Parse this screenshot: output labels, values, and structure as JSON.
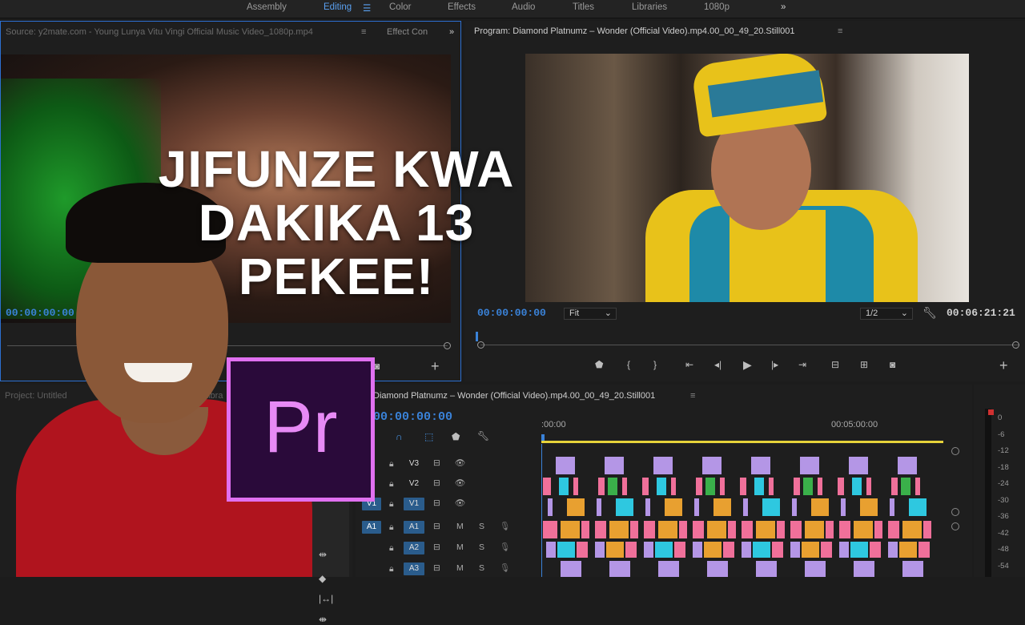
{
  "workspaces": [
    "Assembly",
    "Editing",
    "Color",
    "Effects",
    "Audio",
    "Titles",
    "Libraries",
    "1080p"
  ],
  "workspace_active": "Editing",
  "source": {
    "tab_title": "Source: y2mate.com - Young Lunya  Vitu Vingi Official Music Video_1080p.mp4",
    "tab_effect": "Effect Con",
    "timecode": "00:00:00:00"
  },
  "program": {
    "title": "Program: Diamond Platnumz – Wonder (Official Video).mp4.00_00_49_20.Still001",
    "timecode": "00:00:00:00",
    "fit": "Fit",
    "resolution": "1/2",
    "duration": "00:06:21:21"
  },
  "project": {
    "tab": "Project: Untitled",
    "tab2": "Libra"
  },
  "timeline": {
    "title": "Diamond Platnumz – Wonder (Official Video).mp4.00_00_49_20.Still001",
    "timecode": "00:00:00:00",
    "ruler": [
      ":00:00",
      "00:05:00:00"
    ],
    "tracks": [
      {
        "src": "",
        "name": "V3",
        "m": "",
        "s": ""
      },
      {
        "src": "",
        "name": "V2",
        "m": "",
        "s": ""
      },
      {
        "src": "V1",
        "name": "V1",
        "m": "",
        "s": ""
      },
      {
        "src": "A1",
        "name": "A1",
        "m": "M",
        "s": "S"
      },
      {
        "src": "",
        "name": "A2",
        "m": "M",
        "s": "S"
      },
      {
        "src": "",
        "name": "A3",
        "m": "M",
        "s": "S"
      }
    ]
  },
  "meter": {
    "scale": [
      "0",
      "-6",
      "-12",
      "-18",
      "-24",
      "-30",
      "-36",
      "-42",
      "-48",
      "-54"
    ]
  },
  "overlay": {
    "headline_lines": [
      "JIFUNZE KWA",
      "DAKIKA 13",
      "PEKEE!"
    ],
    "logo": "Pr"
  },
  "colors": {
    "accent": "#5aa0f0",
    "clip_violet": "#b496e6",
    "clip_pink": "#f0709a",
    "clip_cyan": "#2ec8e0",
    "clip_green": "#3ab04a",
    "clip_orange": "#e8a030",
    "track_blue": "#2a5c8c"
  }
}
